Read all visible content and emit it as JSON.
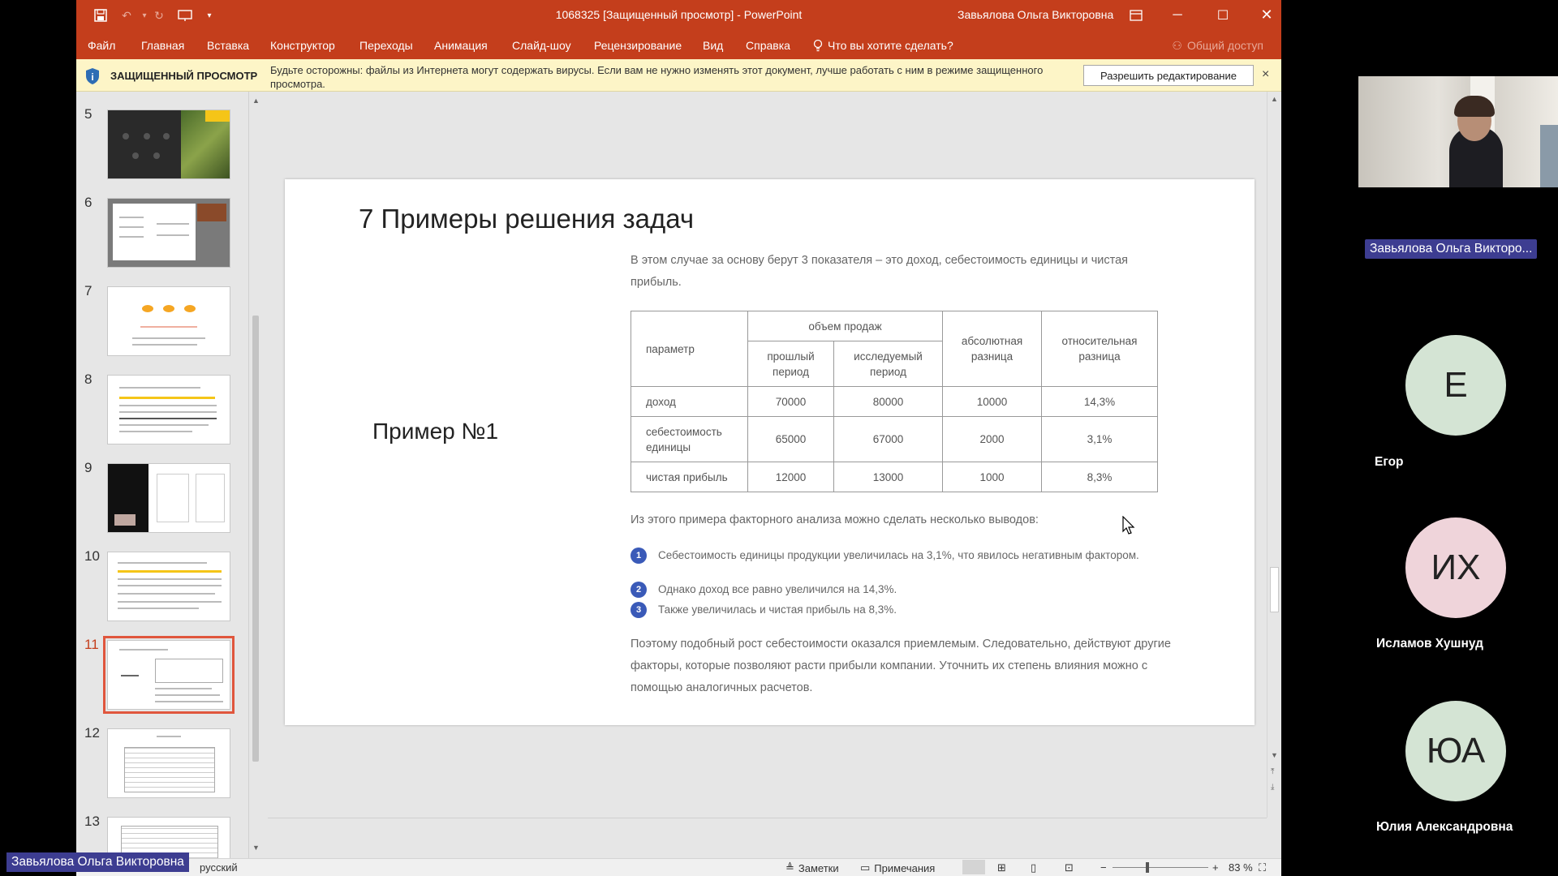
{
  "window": {
    "title": "1068325 [Защищенный просмотр]  -  PowerPoint",
    "user": "Завьялова Ольга Викторовна"
  },
  "menu": {
    "items": [
      "Файл",
      "Главная",
      "Вставка",
      "Конструктор",
      "Переходы",
      "Анимация",
      "Слайд-шоу",
      "Рецензирование",
      "Вид",
      "Справка"
    ],
    "tell_me": "Что вы хотите сделать?",
    "share": "Общий доступ"
  },
  "protected_view": {
    "label": "ЗАЩИЩЕННЫЙ ПРОСМОТР",
    "message": "Будьте осторожны: файлы из Интернета могут содержать вирусы. Если вам не нужно изменять этот документ, лучше работать с ним в режиме защищенного просмотра.",
    "enable_button": "Разрешить редактирование",
    "close": "×"
  },
  "thumbnails": {
    "numbers": [
      "5",
      "6",
      "7",
      "8",
      "9",
      "10",
      "11",
      "12",
      "13"
    ],
    "active": "11"
  },
  "slide": {
    "title": "7 Примеры решения задач",
    "example_label": "Пример №1",
    "intro": "В этом случае за основу берут 3 показателя – это доход, себестоимость единицы и чистая прибыль.",
    "table": {
      "h_param": "параметр",
      "h_sales": "объем продаж",
      "h_prev": "прошлый период",
      "h_studied": "исследуемый период",
      "h_abs": "абсолютная разница",
      "h_rel": "относительная разница",
      "rows": [
        {
          "param": "доход",
          "prev": "70000",
          "studied": "80000",
          "abs": "10000",
          "rel": "14,3%"
        },
        {
          "param": "себестоимость единицы",
          "prev": "65000",
          "studied": "67000",
          "abs": "2000",
          "rel": "3,1%"
        },
        {
          "param": "чистая прибыль",
          "prev": "12000",
          "studied": "13000",
          "abs": "1000",
          "rel": "8,3%"
        }
      ]
    },
    "conclusion": "Из этого примера факторного анализа можно сделать несколько выводов:",
    "bullets": [
      {
        "num": "1",
        "text": "Себестоимость единицы продукции увеличилась на 3,1%, что явилось негативным фактором."
      },
      {
        "num": "2",
        "text": "Однако доход все равно увеличился на 14,3%."
      },
      {
        "num": "3",
        "text": "Также увеличилась и чистая прибыль на 8,3%."
      }
    ],
    "final": "Поэтому подобный рост себестоимости оказался приемлемым. Следовательно, действуют другие факторы, которые позволяют расти прибыли компании. Уточнить их степень влияния можно с помощью аналогичных расчетов."
  },
  "status": {
    "language": "русский",
    "notes": "Заметки",
    "comments": "Примечания",
    "zoom": "83 %"
  },
  "participants": {
    "presenter": "Завьялова Ольга Викторо...",
    "list": [
      {
        "initials": "Е",
        "name": "Егор",
        "color": "#d4e4d4"
      },
      {
        "initials": "ИХ",
        "name": "Исламов Хушнуд",
        "color": "#efd4da"
      },
      {
        "initials": "ЮА",
        "name": "Юлия Александровна",
        "color": "#d4e4d4"
      }
    ],
    "bottom_chip": "Завьялова Ольга Викторовна"
  }
}
